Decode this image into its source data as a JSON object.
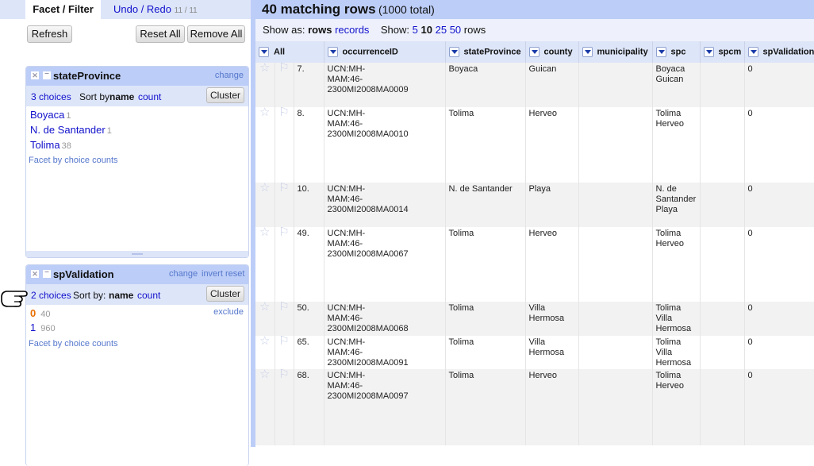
{
  "tabs": {
    "facet_filter": "Facet / Filter",
    "undo_redo": "Undo / Redo",
    "undo_count": "11 / 11"
  },
  "toolbar": {
    "refresh": "Refresh",
    "reset_all": "Reset All",
    "remove_all": "Remove All"
  },
  "facets": [
    {
      "title": "stateProvince",
      "change": "change",
      "choices_label": "3 choices",
      "sort_label": "Sort by:",
      "sort_name": "name",
      "sort_count": "count",
      "cluster": "Cluster",
      "choices": [
        {
          "name": "Boyaca",
          "count": "1"
        },
        {
          "name": "N. de Santander",
          "count": "1"
        },
        {
          "name": "Tolima",
          "count": "38"
        }
      ],
      "facet_by_counts": "Facet by choice counts"
    },
    {
      "title": "spValidation",
      "change": "change",
      "invert": "invert",
      "reset": "reset",
      "choices_label": "2 choices",
      "sort_label": "Sort by:",
      "sort_name": "name",
      "sort_count": "count",
      "cluster": "Cluster",
      "exclude": "exclude",
      "choices": [
        {
          "name": "0",
          "count": "40",
          "selected": true
        },
        {
          "name": "1",
          "count": "960"
        }
      ],
      "facet_by_counts": "Facet by choice counts"
    }
  ],
  "header": {
    "matching": "40 matching rows",
    "total": "(1000 total)"
  },
  "show_bar": {
    "show_as": "Show as:",
    "rows": "rows",
    "records": "records",
    "show": "Show:",
    "sizes": [
      "5",
      "10",
      "25",
      "50"
    ],
    "selected_size": "10",
    "rows_suffix": "rows"
  },
  "columns": [
    "All",
    "occurrenceID",
    "stateProvince",
    "county",
    "municipality",
    "spc",
    "spcm",
    "spValidation"
  ],
  "rows": [
    {
      "num": "7.",
      "occ1": "UCN:MH-",
      "occ2": "MAM:46-2300MI2008MA0009",
      "state": "Boyaca",
      "county": [
        "Guican"
      ],
      "spc": [
        "Boyaca",
        "Guican"
      ],
      "spv": "0"
    },
    {
      "num": "8.",
      "occ1": "UCN:MH-",
      "occ2": "MAM:46-2300MI2008MA0010",
      "state": "Tolima",
      "county": [
        "Herveo"
      ],
      "spc": [
        "Tolima",
        "Herveo"
      ],
      "spv": "0"
    },
    {
      "num": "10.",
      "occ1": "UCN:MH-",
      "occ2": "MAM:46-2300MI2008MA0014",
      "state": "N. de Santander",
      "county": [
        "Playa"
      ],
      "spc": [
        "N. de",
        "Santander",
        "Playa"
      ],
      "spv": "0"
    },
    {
      "num": "49.",
      "occ1": "UCN:MH-",
      "occ2": "MAM:46-2300MI2008MA0067",
      "state": "Tolima",
      "county": [
        "Herveo"
      ],
      "spc": [
        "Tolima",
        "Herveo"
      ],
      "spv": "0"
    },
    {
      "num": "50.",
      "occ1": "UCN:MH-",
      "occ2": "MAM:46-2300MI2008MA0068",
      "state": "Tolima",
      "county": [
        "Villa",
        "Hermosa"
      ],
      "spc": [
        "Tolima",
        "Villa",
        "Hermosa"
      ],
      "spv": "0"
    },
    {
      "num": "65.",
      "occ1": "UCN:MH-",
      "occ2": "MAM:46-2300MI2008MA0091",
      "state": "Tolima",
      "county": [
        "Villa",
        "Hermosa"
      ],
      "spc": [
        "Tolima",
        "Villa",
        "Hermosa"
      ],
      "spv": "0"
    },
    {
      "num": "68.",
      "occ1": "UCN:MH-",
      "occ2": "MAM:46-2300MI2008MA0097",
      "state": "Tolima",
      "county": [
        "Herveo"
      ],
      "spc": [
        "Tolima",
        "Herveo"
      ],
      "spv": "0"
    }
  ]
}
